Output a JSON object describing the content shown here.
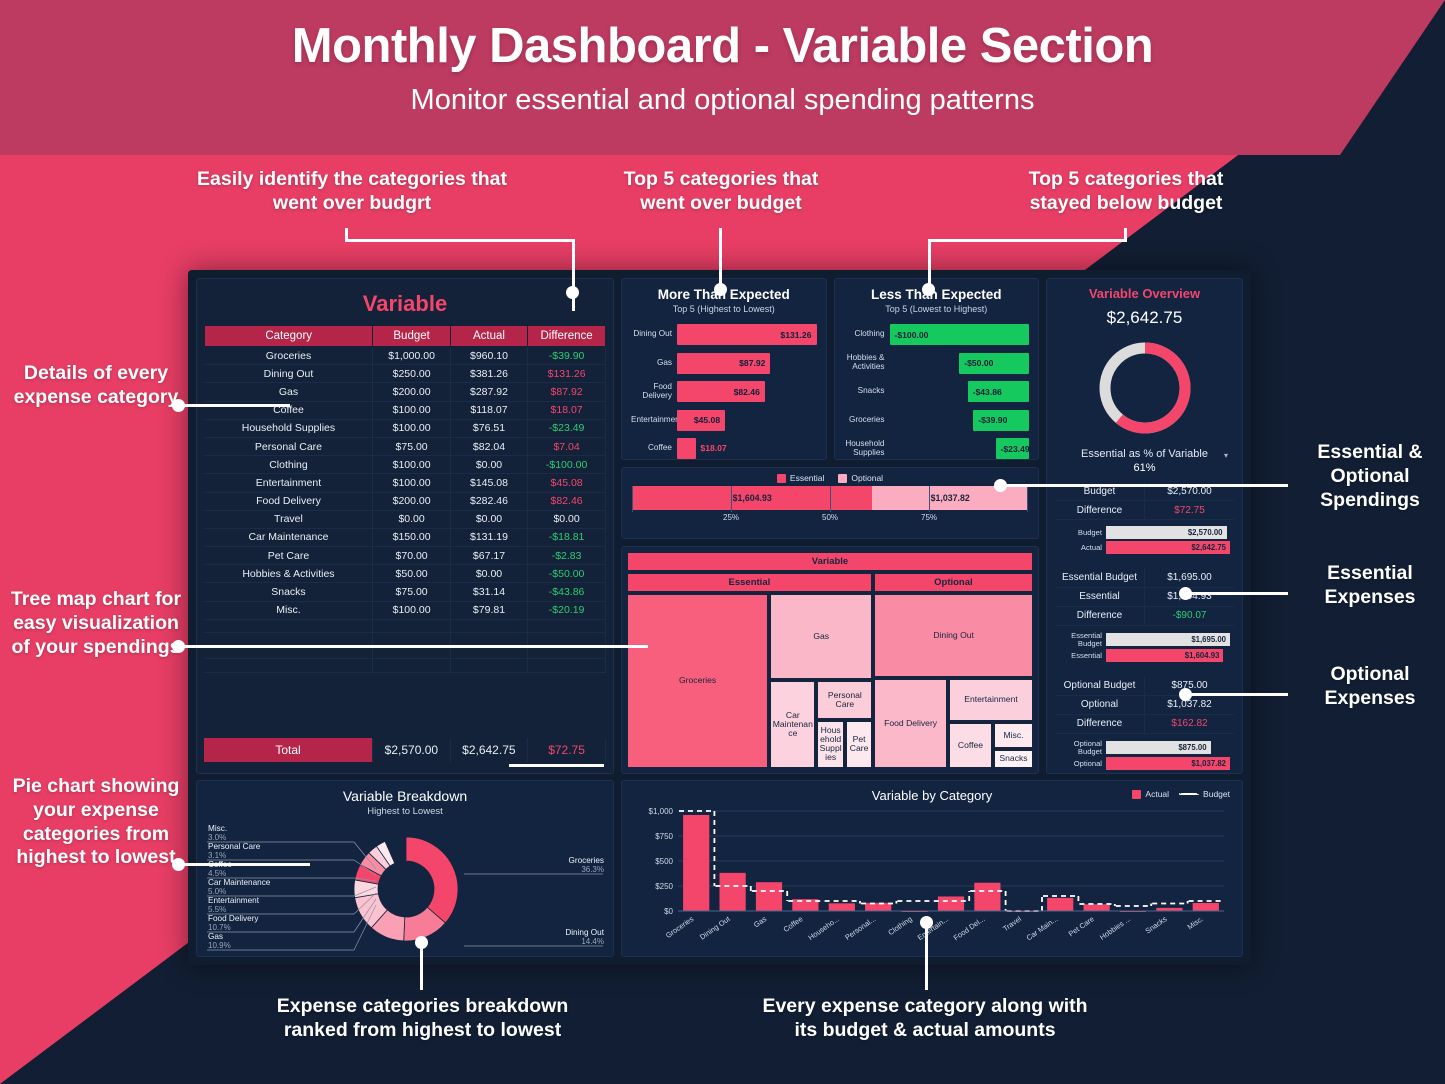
{
  "header": {
    "title": "Monthly Dashboard - Variable Section",
    "subtitle": "Monitor essential and optional spending patterns"
  },
  "colors": {
    "pink": "#f4466b",
    "pink_light": "#fbacc0",
    "crimson": "#b5254a",
    "green": "#16c95f",
    "green_text": "#2ecc71",
    "panel": "#132441",
    "background": "#121e33",
    "gray_bar": "#e2e2e2"
  },
  "annotations": [
    {
      "id": "anno-table",
      "text": "Easily identify the categories that went over budgrt"
    },
    {
      "id": "anno-more",
      "text": "Top 5 categories that went over budget"
    },
    {
      "id": "anno-less",
      "text": "Top 5 categories that stayed below budget"
    },
    {
      "id": "anno-details",
      "text": "Details of every expense category"
    },
    {
      "id": "anno-tree",
      "text": "Tree map chart for easy visualization of your spendings"
    },
    {
      "id": "anno-pie",
      "text": "Pie chart showing your expense categories from highest to lowest"
    },
    {
      "id": "anno-eo",
      "text": "Essential & Optional Spendings"
    },
    {
      "id": "anno-ess",
      "text": "Essential Expenses"
    },
    {
      "id": "anno-opt",
      "text": "Optional Expenses"
    },
    {
      "id": "anno-bd",
      "text": "Expense categories breakdown ranked from highest to lowest"
    },
    {
      "id": "anno-bc",
      "text": "Every expense category along with its budget & actual amounts"
    }
  ],
  "table": {
    "title": "Variable",
    "columns": [
      "Category",
      "Budget",
      "Actual",
      "Difference"
    ],
    "rows": [
      {
        "category": "Groceries",
        "budget": "$1,000.00",
        "actual": "$960.10",
        "difference": "-$39.90",
        "sign": "neg"
      },
      {
        "category": "Dining Out",
        "budget": "$250.00",
        "actual": "$381.26",
        "difference": "$131.26",
        "sign": "pos"
      },
      {
        "category": "Gas",
        "budget": "$200.00",
        "actual": "$287.92",
        "difference": "$87.92",
        "sign": "pos"
      },
      {
        "category": "Coffee",
        "budget": "$100.00",
        "actual": "$118.07",
        "difference": "$18.07",
        "sign": "pos"
      },
      {
        "category": "Household Supplies",
        "budget": "$100.00",
        "actual": "$76.51",
        "difference": "-$23.49",
        "sign": "neg"
      },
      {
        "category": "Personal Care",
        "budget": "$75.00",
        "actual": "$82.04",
        "difference": "$7.04",
        "sign": "pos"
      },
      {
        "category": "Clothing",
        "budget": "$100.00",
        "actual": "$0.00",
        "difference": "-$100.00",
        "sign": "neg"
      },
      {
        "category": "Entertainment",
        "budget": "$100.00",
        "actual": "$145.08",
        "difference": "$45.08",
        "sign": "pos"
      },
      {
        "category": "Food Delivery",
        "budget": "$200.00",
        "actual": "$282.46",
        "difference": "$82.46",
        "sign": "pos"
      },
      {
        "category": "Travel",
        "budget": "$0.00",
        "actual": "$0.00",
        "difference": "$0.00",
        "sign": "zero"
      },
      {
        "category": "Car Maintenance",
        "budget": "$150.00",
        "actual": "$131.19",
        "difference": "-$18.81",
        "sign": "neg"
      },
      {
        "category": "Pet Care",
        "budget": "$70.00",
        "actual": "$67.17",
        "difference": "-$2.83",
        "sign": "neg"
      },
      {
        "category": "Hobbies & Activities",
        "budget": "$50.00",
        "actual": "$0.00",
        "difference": "-$50.00",
        "sign": "neg"
      },
      {
        "category": "Snacks",
        "budget": "$75.00",
        "actual": "$31.14",
        "difference": "-$43.86",
        "sign": "neg"
      },
      {
        "category": "Misc.",
        "budget": "$100.00",
        "actual": "$79.81",
        "difference": "-$20.19",
        "sign": "neg"
      }
    ],
    "total": {
      "label": "Total",
      "budget": "$2,570.00",
      "actual": "$2,642.75",
      "difference": "$72.75"
    }
  },
  "more_than_expected": {
    "title": "More Than Expected",
    "subtitle": "Top 5 (Highest to Lowest)",
    "items": [
      {
        "label": "Dining Out",
        "value": "$131.26",
        "pct": 100
      },
      {
        "label": "Gas",
        "value": "$87.92",
        "pct": 67
      },
      {
        "label": "Food Delivery",
        "value": "$82.46",
        "pct": 63
      },
      {
        "label": "Entertainment",
        "value": "$45.08",
        "pct": 34.5
      },
      {
        "label": "Coffee",
        "value": "$18.07",
        "pct": 13.8
      }
    ]
  },
  "less_than_expected": {
    "title": "Less Than Expected",
    "subtitle": "Top 5 (Lowest to Highest)",
    "items": [
      {
        "label": "Clothing",
        "value": "-$100.00",
        "pct": 100
      },
      {
        "label": "Hobbies & Activities",
        "value": "-$50.00",
        "pct": 50
      },
      {
        "label": "Snacks",
        "value": "-$43.86",
        "pct": 44
      },
      {
        "label": "Groceries",
        "value": "-$39.90",
        "pct": 40
      },
      {
        "label": "Household Supplies",
        "value": "-$23.49",
        "pct": 24
      }
    ]
  },
  "stacked": {
    "legend": [
      "Essential",
      "Optional"
    ],
    "essential_value": "$1,604.93",
    "optional_value": "$1,037.82",
    "essential_pct": 60.7,
    "optional_pct": 39.3,
    "ticks": [
      "25%",
      "50%",
      "75%"
    ]
  },
  "treemap": {
    "root": "Variable",
    "groups": [
      "Essential",
      "Optional"
    ],
    "essential": [
      {
        "label": "Groceries",
        "value": 960.1
      },
      {
        "label": "Gas",
        "value": 287.92
      },
      {
        "label": "Personal Care",
        "value": 82.04
      },
      {
        "label": "Car Maintenance",
        "value": 131.19
      },
      {
        "label": "Household Supplies",
        "value": 76.51
      },
      {
        "label": "Pet Care",
        "value": 67.17
      }
    ],
    "optional": [
      {
        "label": "Dining Out",
        "value": 381.26
      },
      {
        "label": "Food Delivery",
        "value": 282.46
      },
      {
        "label": "Entertainment",
        "value": 145.08
      },
      {
        "label": "Coffee",
        "value": 118.07
      },
      {
        "label": "Misc.",
        "value": 79.81
      },
      {
        "label": "Snacks",
        "value": 31.14
      }
    ]
  },
  "overview": {
    "title": "Variable Overview",
    "amount": "$2,642.75",
    "donut_caption": "Essential as % of Variable",
    "donut_pct_label": "61%",
    "donut_pct": 61,
    "metrics": [
      {
        "k": "Budget",
        "v": "$2,570.00",
        "color": ""
      },
      {
        "k": "Difference",
        "v": "$72.75",
        "color": "red"
      }
    ],
    "bars_total": [
      {
        "label": "Budget",
        "value": "$2,570.00",
        "pct": 97.2,
        "style": "gray"
      },
      {
        "label": "Actual",
        "value": "$2,642.75",
        "pct": 100,
        "style": "pink"
      }
    ],
    "essential_metrics": [
      {
        "k": "Essential Budget",
        "v": "$1,695.00",
        "color": ""
      },
      {
        "k": "Essential",
        "v": "$1,604.93",
        "color": ""
      },
      {
        "k": "Difference",
        "v": "-$90.07",
        "color": "green"
      }
    ],
    "bars_essential": [
      {
        "label": "Essential Budget",
        "value": "$1,695.00",
        "pct": 100,
        "style": "gray"
      },
      {
        "label": "Essential",
        "value": "$1,604.93",
        "pct": 94.7,
        "style": "pink"
      }
    ],
    "optional_metrics": [
      {
        "k": "Optional Budget",
        "v": "$875.00",
        "color": ""
      },
      {
        "k": "Optional",
        "v": "$1,037.82",
        "color": ""
      },
      {
        "k": "Difference",
        "v": "$162.82",
        "color": "red"
      }
    ],
    "bars_optional": [
      {
        "label": "Optional Budget",
        "value": "$875.00",
        "pct": 84.3,
        "style": "gray"
      },
      {
        "label": "Optional",
        "value": "$1,037.82",
        "pct": 100,
        "style": "pink"
      }
    ]
  },
  "chart_data": [
    {
      "type": "pie",
      "title": "Variable Breakdown",
      "subtitle": "Highest to Lowest",
      "legend_position": "callout-labels",
      "categories": [
        "Groceries",
        "Dining Out",
        "Gas",
        "Food Delivery",
        "Entertainment",
        "Car Maintenance",
        "Coffee",
        "Personal Care",
        "Misc."
      ],
      "values": [
        36.3,
        14.4,
        10.9,
        10.7,
        5.5,
        5.0,
        4.5,
        3.1,
        3.0
      ],
      "value_labels": [
        "36.3%",
        "14.4%",
        "10.9%",
        "10.7%",
        "5.5%",
        "5.0%",
        "4.5%",
        "3.1%",
        "3.0%"
      ],
      "left_labels": [
        {
          "label": "Misc.",
          "pct": "3.0%"
        },
        {
          "label": "Personal Care",
          "pct": "3.1%"
        },
        {
          "label": "Coffee",
          "pct": "4.5%"
        },
        {
          "label": "Car Maintenance",
          "pct": "5.0%"
        },
        {
          "label": "Entertainment",
          "pct": "5.5%"
        },
        {
          "label": "Food Delivery",
          "pct": "10.7%"
        },
        {
          "label": "Gas",
          "pct": "10.9%"
        }
      ],
      "right_labels": [
        {
          "label": "Groceries",
          "pct": "36.3%"
        },
        {
          "label": "Dining Out",
          "pct": "14.4%"
        }
      ]
    },
    {
      "type": "bar",
      "title": "Variable by Category",
      "legend": [
        "Actual",
        "Budget"
      ],
      "categories": [
        "Groceries",
        "Dining Out",
        "Gas",
        "Coffee",
        "Househo...",
        "Personal...",
        "Clothing",
        "Entertain...",
        "Food Del...",
        "Travel",
        "Car Main...",
        "Pet Care",
        "Hobbies ...",
        "Snacks",
        "Misc."
      ],
      "series": [
        {
          "name": "Actual",
          "values": [
            960.1,
            381.26,
            287.92,
            118.07,
            76.51,
            82.04,
            0.0,
            145.08,
            282.46,
            0.0,
            131.19,
            67.17,
            0.0,
            31.14,
            79.81
          ]
        },
        {
          "name": "Budget",
          "values": [
            1000.0,
            250.0,
            200.0,
            100.0,
            100.0,
            75.0,
            100.0,
            100.0,
            200.0,
            0.0,
            150.0,
            70.0,
            50.0,
            75.0,
            100.0
          ]
        }
      ],
      "ylabel": "",
      "xlabel": "",
      "ylim": [
        0,
        1000
      ],
      "yticks": [
        "$0",
        "$250",
        "$500",
        "$750",
        "$1,000"
      ],
      "grid": true
    }
  ]
}
